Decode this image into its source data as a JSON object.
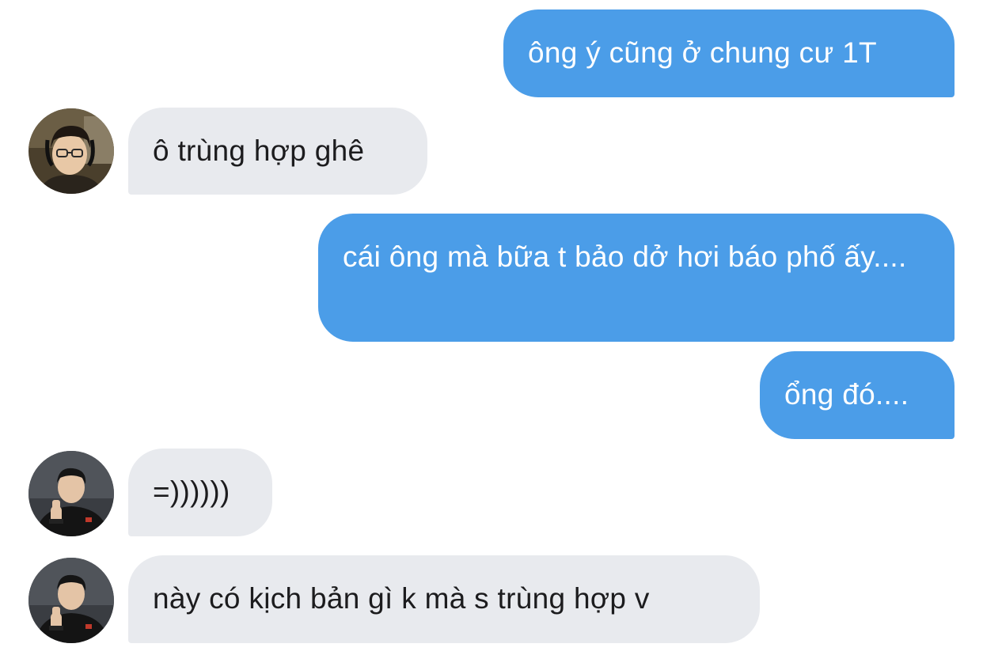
{
  "conversation": {
    "messages": [
      {
        "from": "me",
        "text": "ông ý cũng ở chung cư 1T"
      },
      {
        "from": "contact_a",
        "text": "ô trùng hợp ghê"
      },
      {
        "from": "me",
        "text": "cái ông mà bữa t bảo dở hơi báo phố ấy...."
      },
      {
        "from": "me",
        "text": "ổng đó...."
      },
      {
        "from": "contact_b",
        "text": "=))))))"
      },
      {
        "from": "contact_b",
        "text": "này có kịch bản gì k mà s trùng hợp v"
      }
    ]
  },
  "colors": {
    "sent_bubble": "#4b9de8",
    "received_bubble": "#e8eaee",
    "sent_text": "#ffffff",
    "received_text": "#1c1c1e"
  },
  "icons": {
    "contact_a_avatar": "avatar-icon",
    "contact_b_avatar": "avatar-icon"
  }
}
